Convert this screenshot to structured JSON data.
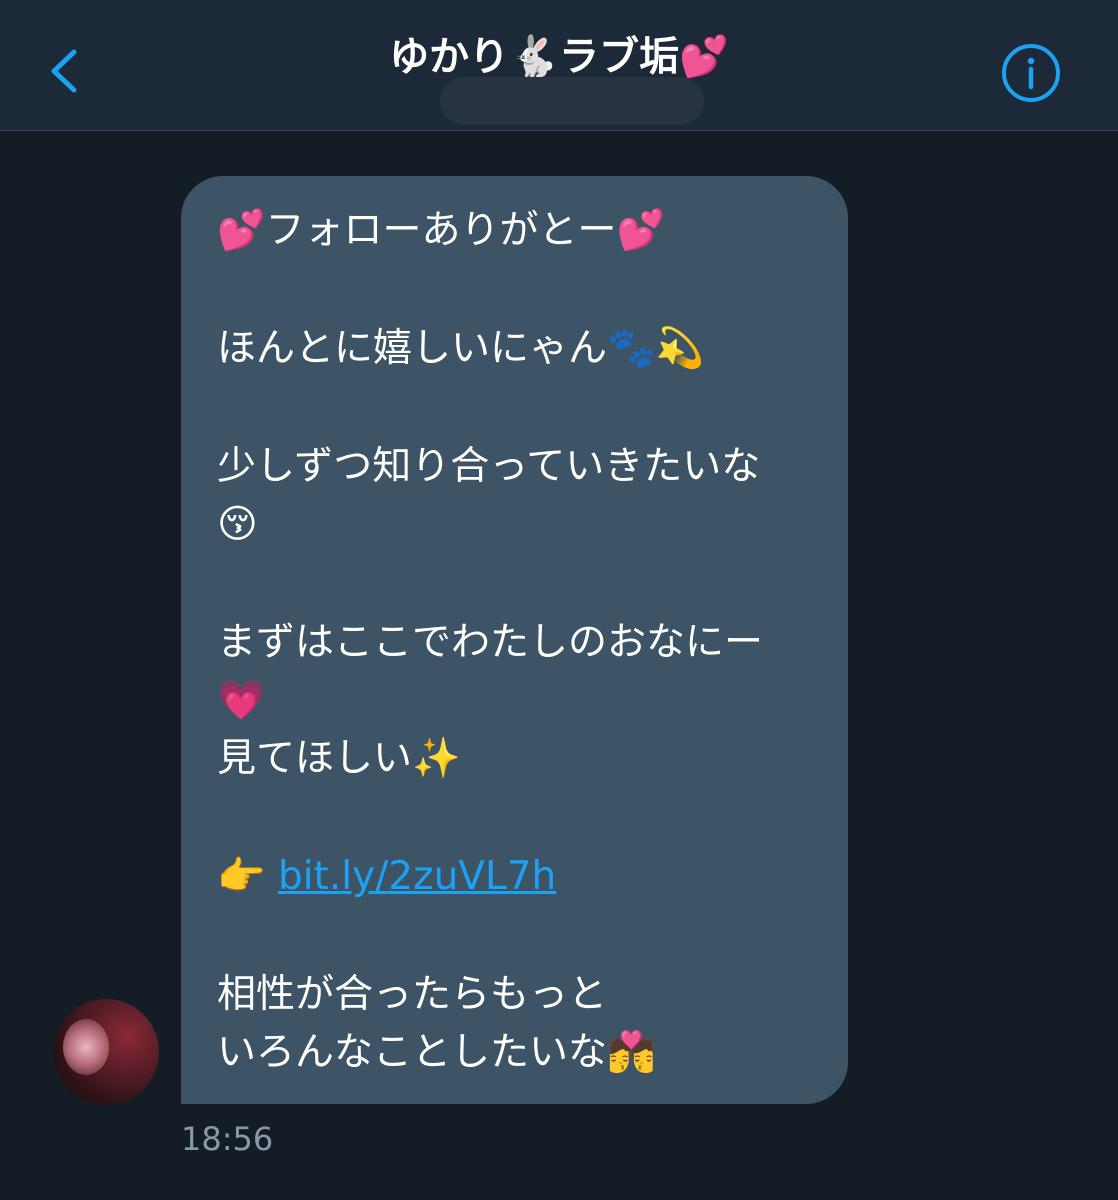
{
  "header": {
    "title": "ゆかり🐇ラブ垢💕",
    "back_icon": "chevron-left-icon",
    "info_icon": "info-circle-icon",
    "accent_color": "#1da1f2"
  },
  "message": {
    "lines": [
      "💕フォローありがとー💕",
      "",
      "ほんとに嬉しいにゃん🐾💫",
      "",
      "少しずつ知り合っていきたいな",
      "😚",
      "",
      "まずはここでわたしのおなにー",
      "💗",
      "見てほしい✨",
      "",
      "👉 ",
      "",
      "相性が合ったらもっと",
      "いろんなことしたいな💏"
    ],
    "link_text": "bit.ly/2zuVL7h",
    "timestamp": "18:56"
  }
}
